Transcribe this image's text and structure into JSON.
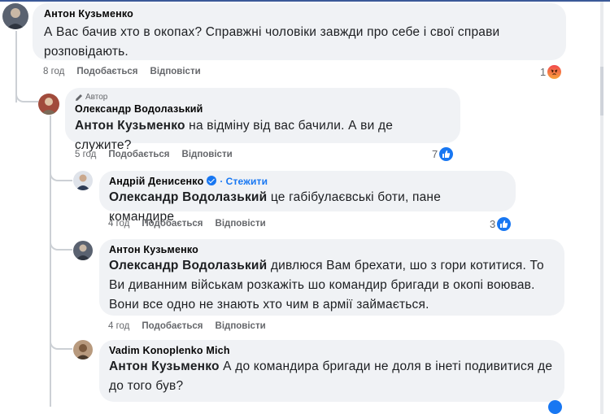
{
  "comments": [
    {
      "author": "Антон Кузьменко",
      "text": "А Вас бачив хто в окопах? Справжні чоловіки завжди про себе і свої справи розповідають.",
      "time": "8 год",
      "like_label": "Подобається",
      "reply_label": "Відповісти",
      "reaction_count": "1",
      "reaction_icon": "angry-reaction-icon"
    },
    {
      "author_badge": "Автор",
      "author": "Олександр Водолазький",
      "mention": "Антон Кузьменко",
      "text": " на відміну від вас бачили. А ви де служите?",
      "time": "5 год",
      "like_label": "Подобається",
      "reply_label": "Відповісти",
      "reaction_count": "7",
      "reaction_icon": "like-reaction-icon"
    },
    {
      "author": "Андрій Денисенко",
      "follow_label": "Стежити",
      "mention": "Олександр Водолазький",
      "text": " це габібулаєвські боти, пане командире",
      "time": "4 год",
      "like_label": "Подобається",
      "reply_label": "Відповісти",
      "reaction_count": "3",
      "reaction_icon": "like-reaction-icon"
    },
    {
      "author": "Антон Кузьменко",
      "mention": "Олександр Водолазький",
      "text": " дивлюся Вам брехати, шо з гори котитися. То Ви диванним військам розкажіть шо командир бригади в окопі воював. Вони все одно не знають хто чим в армії займається.",
      "time": "4 год",
      "like_label": "Подобається",
      "reply_label": "Відповісти"
    },
    {
      "author": "Vadim Konoplenko Mich",
      "mention": "Антон Кузьменко",
      "text": " А до командира бригади не доля в інеті подивитися де до того був?"
    }
  ],
  "colors": {
    "like": "#1877f2",
    "bubble": "#f0f2f5",
    "meta": "#65676b"
  }
}
